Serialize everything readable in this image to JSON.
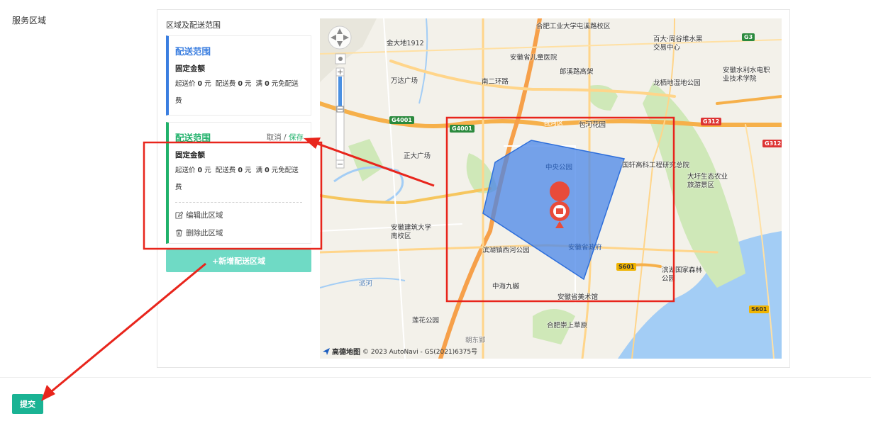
{
  "page": {
    "side_label": "服务区域",
    "panel_title": "区域及配送范围",
    "submit_label": "提交"
  },
  "cards": [
    {
      "title": "配送范围",
      "fixed_amount": "固定金额",
      "start_price_label": "起送价",
      "start_price": "0",
      "fee_label": "配送费",
      "fee": "0",
      "free_label": "满",
      "free_value": "0",
      "free_suffix_line1": "元免配送",
      "free_suffix_line2": "费",
      "yuan": "元"
    },
    {
      "title": "配送范围",
      "cancel_label": "取消",
      "separator": "/",
      "save_label": "保存",
      "fixed_amount": "固定金额",
      "start_price_label": "起送价",
      "start_price": "0",
      "fee_label": "配送费",
      "fee": "0",
      "free_label": "满",
      "free_value": "0",
      "free_suffix_line1": "元免配送",
      "free_suffix_line2": "费",
      "yuan": "元",
      "edit_label": "编辑此区域",
      "delete_label": "删除此区域",
      "edit_icon": "edit-icon",
      "delete_icon": "trash-icon"
    }
  ],
  "add_button_label": "+新增配送区域",
  "map": {
    "credits_brand": "高德地图",
    "credits_text": "© 2023 AutoNavi - GS(2021)6375号",
    "labels": [
      "金大地1912",
      "合肥工业大学屯溪路校区",
      "安徽省儿童医院",
      "郎溪路高架",
      "万达广场",
      "南二环路",
      "包河区",
      "包河花园",
      "正大广场",
      "中央公园",
      "国轩高科工程研究总院",
      "安徽建筑大学南校区",
      "安徽省政府",
      "滨湖国家森林公园",
      "滨湖镇西河公园",
      "中海九樾",
      "安徽省美术馆",
      "合肥崇上草原",
      "莲花公园",
      "大圩生态农业旅游景区",
      "龙栖地湿地公园",
      "安徽水利水电职业技术学院",
      "百大·周谷堆水果交易中心",
      "派河",
      "朝东郢"
    ],
    "road_badges": [
      "G3",
      "G4001",
      "G4001",
      "G312",
      "G312",
      "S601",
      "S601"
    ],
    "colors": {
      "polygon_fill": "#4a86e8",
      "annotation_red": "#e8251c",
      "water": "#a3cdf5",
      "park": "#cfe8b8",
      "pin": "#e84b3a"
    }
  },
  "colors": {
    "primary_green": "#1ab394",
    "blue_accent": "#3a7ee0",
    "card_green": "#1fb16a",
    "add_button": "#6fdac5"
  }
}
